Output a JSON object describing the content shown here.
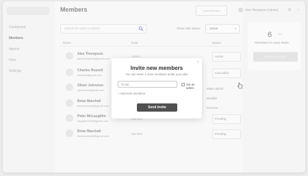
{
  "sidebar": {
    "items": [
      {
        "label": "Dashboard",
        "active": false
      },
      {
        "label": "Members",
        "active": true
      },
      {
        "label": "Agents",
        "active": false
      },
      {
        "label": "Files",
        "active": false
      },
      {
        "label": "Settings",
        "active": false
      }
    ]
  },
  "header": {
    "title": "Members",
    "action_label": "Invite Member"
  },
  "search": {
    "placeholder": "Search for users or teams",
    "icon": "search-icon"
  },
  "filter": {
    "label": "Show with status:",
    "value": "Active"
  },
  "table": {
    "columns": [
      "Name",
      "Role",
      "Status"
    ],
    "rows": [
      {
        "name": "Alex Thompson",
        "email": "alexthompson@gmail.com",
        "role": "Admin",
        "status": "Active"
      },
      {
        "name": "Charles Russell",
        "email": "charlesr@gmail.com",
        "role": "Member",
        "status": "Cancelled"
      },
      {
        "name": "Oliver Johnston",
        "email": "ojohnston@gmail.com",
        "role": "Member",
        "status": ""
      },
      {
        "name": "Brian Marshall",
        "email": "brianmarshall@gmail.com",
        "role": "Member",
        "status": ""
      },
      {
        "name": "Peter McLaughlin",
        "email": "laughlin1029@gmail.com",
        "role": "Member",
        "status": "Pending"
      },
      {
        "name": "Brian Marshall",
        "email": "brianmarshall@gmail.com",
        "role": "Member",
        "status": "Pending"
      }
    ],
    "status_menu": [
      "Make admin",
      "Disable",
      "Remove"
    ]
  },
  "user": {
    "name": "Alex Thompson (Admin)"
  },
  "stats": {
    "count": "6",
    "count_suffix": "/10",
    "label": "members in your team",
    "invite_label": "Invite a member"
  },
  "modal": {
    "title": "Invite new members",
    "subtitle": "You can invite 4 more members under your plan",
    "email_placeholder": "Email...",
    "admin_label": "Set as admin",
    "add_more": "+ Add more members",
    "send_label": "Send invite",
    "close_glyph": "×"
  },
  "colors": {
    "primary_button": "#505050",
    "modal_bg": "#ffffff",
    "page_bg": "#f5f5f5"
  }
}
